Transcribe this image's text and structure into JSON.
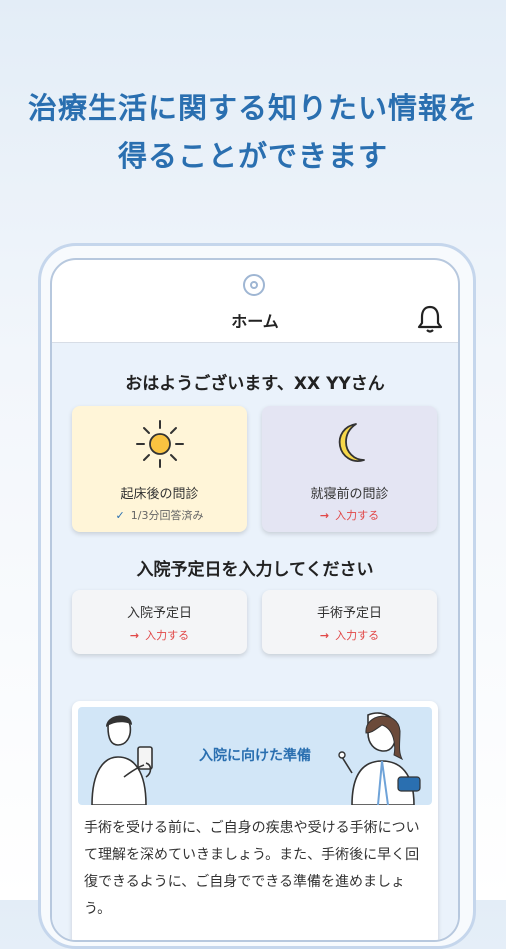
{
  "promo": {
    "line1": "治療生活に関する知りたい情報を",
    "line2": "得ることができます"
  },
  "header": {
    "title": "ホーム"
  },
  "greeting": "おはようございます、XX YYさん",
  "questionnaires": {
    "morning": {
      "title": "起床後の問診",
      "status": "1/3分回答済み",
      "status_icon": "check-icon"
    },
    "night": {
      "title": "就寝前の問診",
      "status": "入力する",
      "status_icon": "arrow-right-icon"
    }
  },
  "dates_section": {
    "title": "入院予定日を入力してください",
    "admission": {
      "title": "入院予定日",
      "action": "入力する"
    },
    "surgery": {
      "title": "手術予定日",
      "action": "入力する"
    }
  },
  "feature": {
    "banner_title": "入院に向けた準備",
    "body": "手術を受ける前に、ご自身の疾患や受ける手術について理解を深めていきましょう。また、手術後に早く回復できるように、ご自身でできる準備を進めましょう。"
  },
  "colors": {
    "accent_blue": "#2a6fb0",
    "todo_red": "#e14848",
    "morning_card": "#fff5d8",
    "night_card": "#e4e5f3"
  }
}
